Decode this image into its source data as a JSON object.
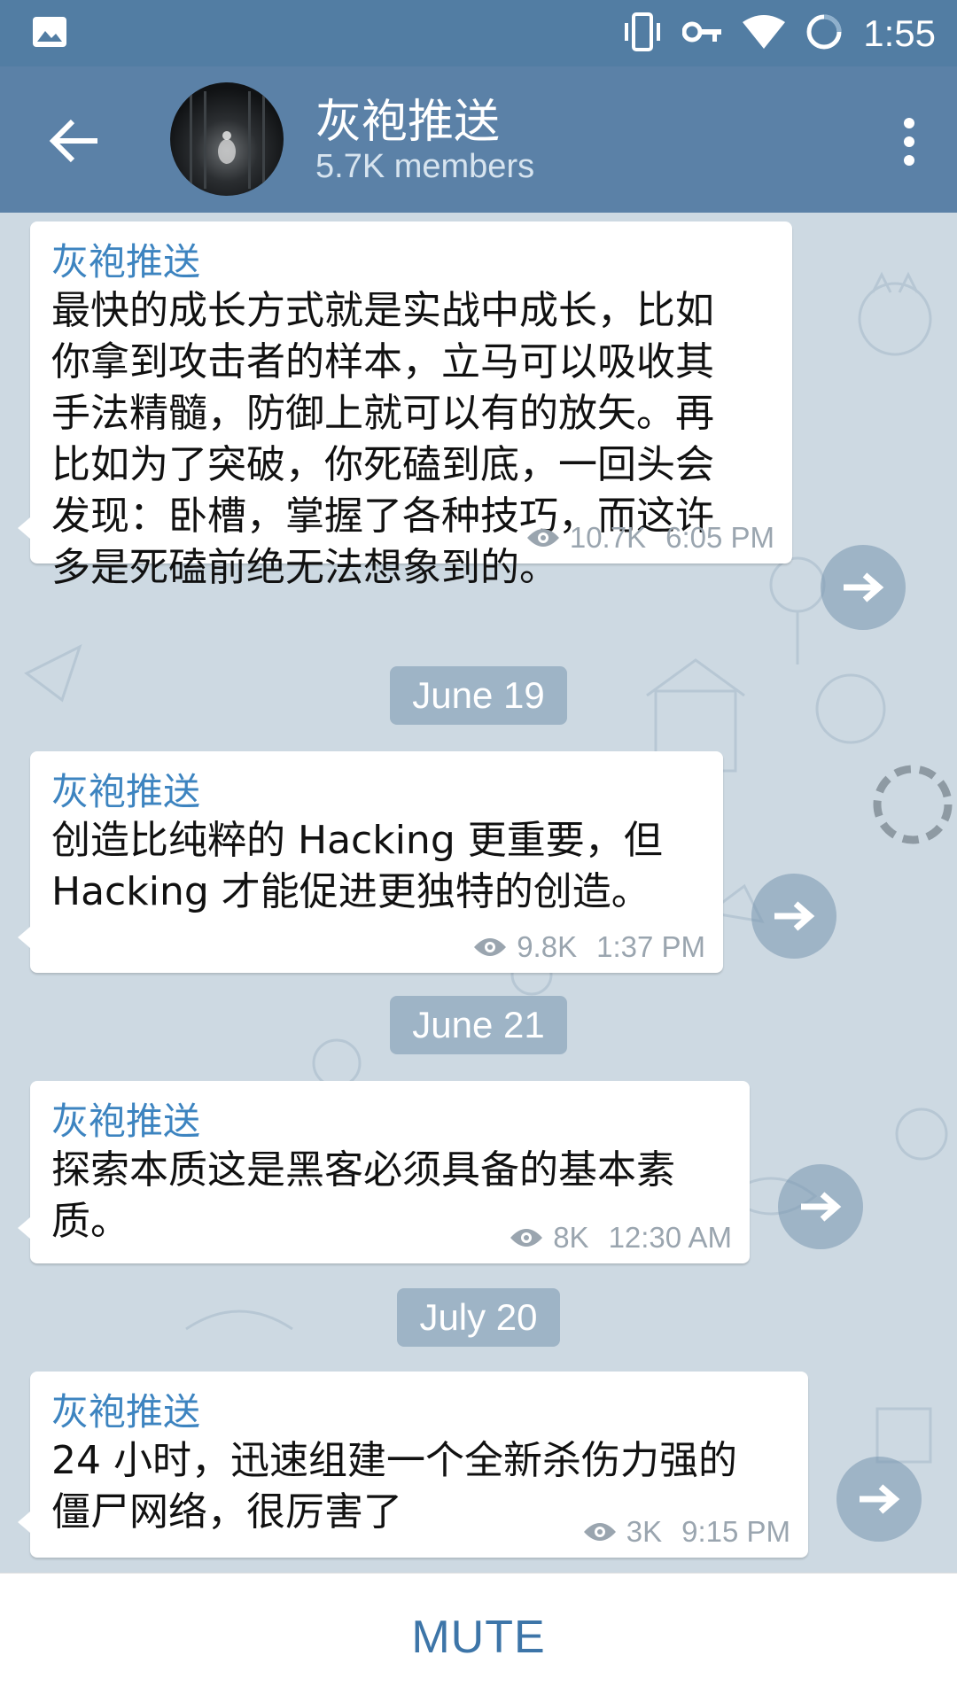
{
  "status_bar": {
    "time": "1:55",
    "icons": [
      "image-icon",
      "vibrate-icon",
      "vpn-key-icon",
      "wifi-icon",
      "sync-icon"
    ]
  },
  "app_bar": {
    "title": "灰袍推送",
    "subtitle": "5.7K members",
    "icons": [
      "back-arrow-icon",
      "more-vert-icon"
    ]
  },
  "messages": [
    {
      "sender": "灰袍推送",
      "lines": [
        "最快的成长方式就是实战中成长，比如",
        "你拿到攻击者的样本，立马可以吸收其",
        "手法精髓，防御上就可以有的放矢。再",
        "比如为了突破，你死磕到底，一回头会",
        "发现：卧槽，掌握了各种技巧，而这许",
        "多是死磕前绝无法想象到的。"
      ],
      "views": "10.7K",
      "time": "6:05 PM"
    },
    {
      "sender": "灰袍推送",
      "lines": [
        "创造比纯粹的 Hacking 更重要，但",
        "Hacking 才能促进更独特的创造。"
      ],
      "views": "9.8K",
      "time": "1:37 PM"
    },
    {
      "sender": "灰袍推送",
      "lines": [
        "探索本质这是黑客必须具备的基本素",
        "质。"
      ],
      "views": "8K",
      "time": "12:30 AM"
    },
    {
      "sender": "灰袍推送",
      "lines": [
        "24 小时，迅速组建一个全新杀伤力强的",
        "僵尸网络，很厉害了"
      ],
      "views": "3K",
      "time": "9:15 PM"
    }
  ],
  "dates": [
    "June 19",
    "June 21",
    "July 20"
  ],
  "bottom": {
    "mute_label": "MUTE"
  },
  "colors": {
    "header": "#5b81a7",
    "status_bar": "#527da3",
    "sender": "#3d84c0",
    "mute": "#3d75a8",
    "chat_bg": "#cdd9e2"
  }
}
